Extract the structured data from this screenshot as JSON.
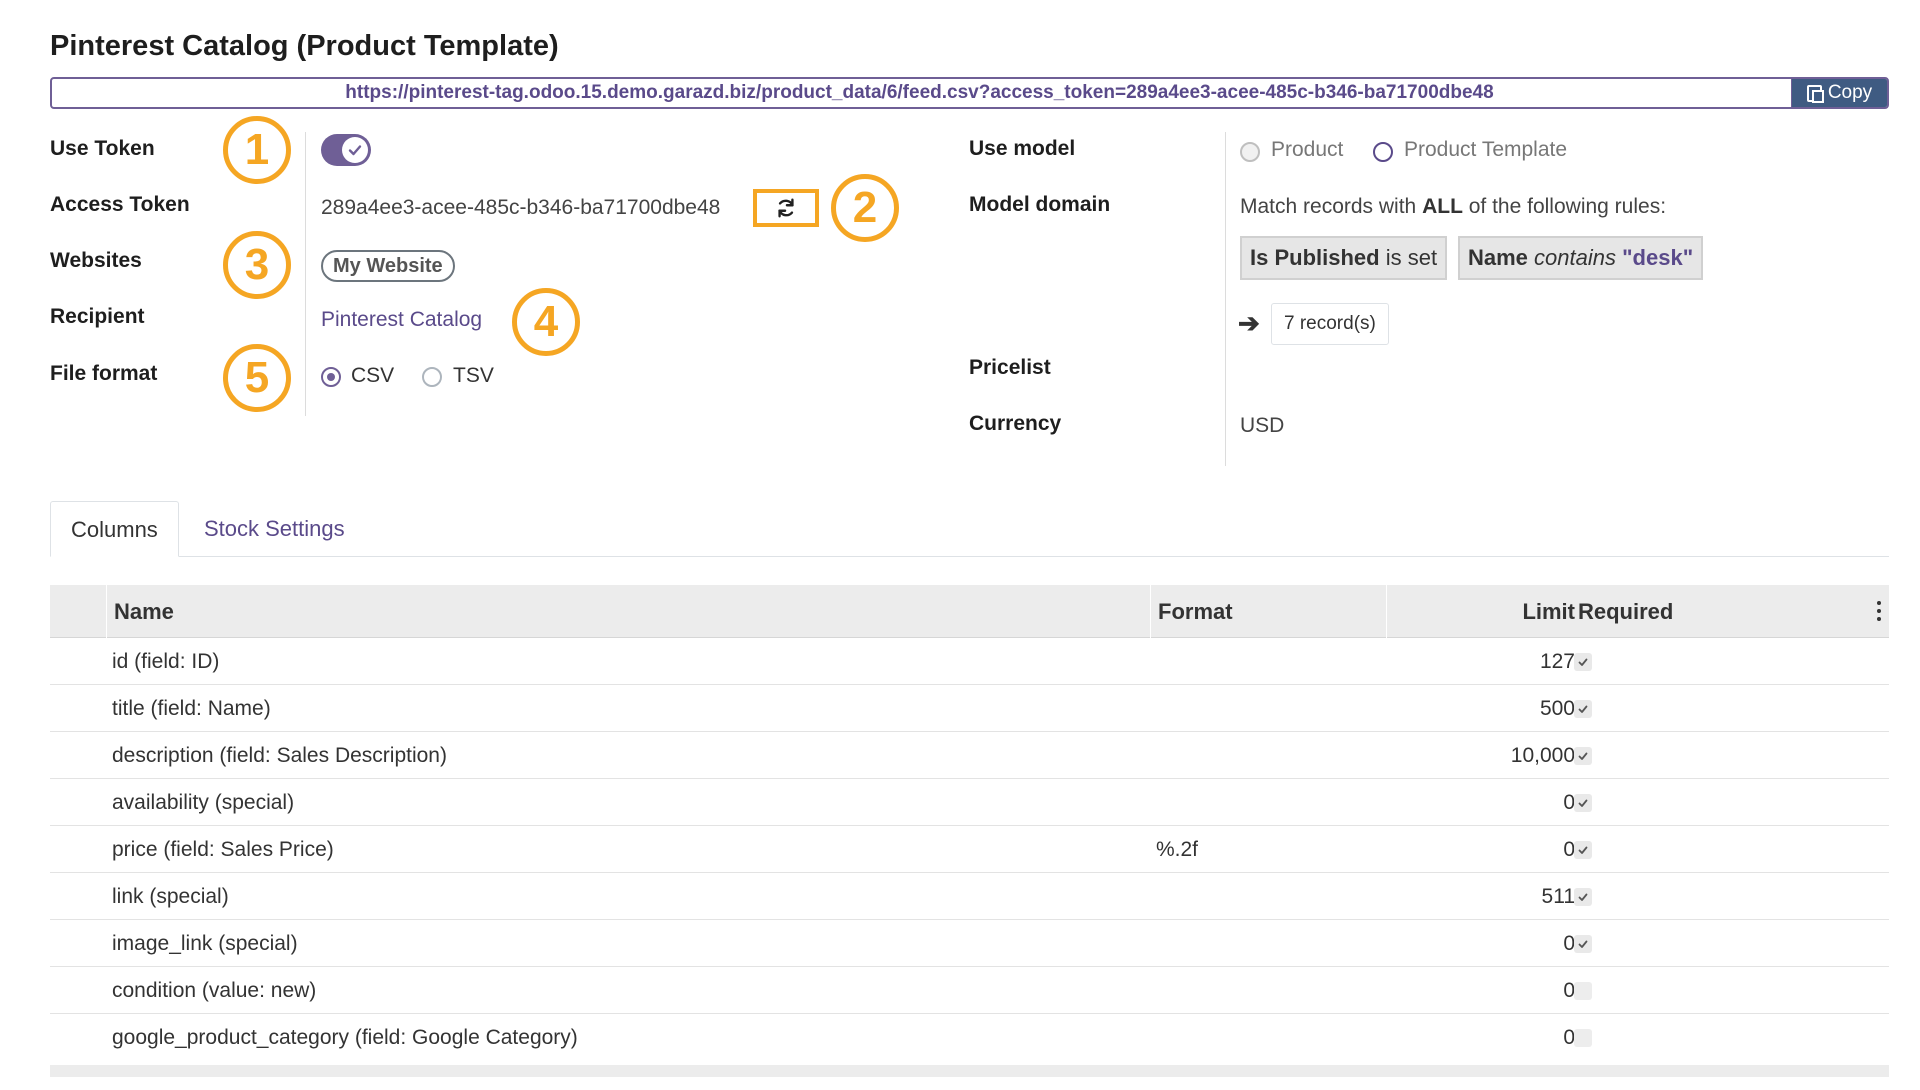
{
  "header": {
    "title": "Pinterest Catalog (Product Template)",
    "feed_url": "https://pinterest-tag.odoo.15.demo.garazd.biz/product_data/6/feed.csv?access_token=289a4ee3-acee-485c-b346-ba71700dbe48",
    "copy_label": "Copy"
  },
  "left_fields": {
    "use_token_label": "Use Token",
    "use_token_value": true,
    "access_token_label": "Access Token",
    "access_token_value": "289a4ee3-acee-485c-b346-ba71700dbe48",
    "websites_label": "Websites",
    "websites_tag": "My Website",
    "recipient_label": "Recipient",
    "recipient_value": "Pinterest Catalog",
    "file_format_label": "File format",
    "file_format_options": [
      "CSV",
      "TSV"
    ],
    "file_format_selected": "CSV"
  },
  "right_fields": {
    "use_model_label": "Use model",
    "use_model_options": [
      "Product",
      "Product Template"
    ],
    "model_domain_label": "Model domain",
    "domain_prefix": "Match records with",
    "domain_all": "ALL",
    "domain_suffix": "of the following rules:",
    "rule1_field": "Is Published",
    "rule1_op": "is set",
    "rule2_field": "Name",
    "rule2_op": "contains",
    "rule2_value": "\"desk\"",
    "records_label": "7 record(s)",
    "pricelist_label": "Pricelist",
    "currency_label": "Currency",
    "currency_value": "USD"
  },
  "callouts": [
    "1",
    "2",
    "3",
    "4",
    "5"
  ],
  "tabs": [
    {
      "label": "Columns",
      "active": true
    },
    {
      "label": "Stock Settings",
      "active": false
    }
  ],
  "table": {
    "headers": {
      "name": "Name",
      "format": "Format",
      "limit": "Limit",
      "required": "Required"
    },
    "rows": [
      {
        "name": "id (field: ID)",
        "format": "",
        "limit": "127",
        "required": true
      },
      {
        "name": "title (field: Name)",
        "format": "",
        "limit": "500",
        "required": true
      },
      {
        "name": "description (field: Sales Description)",
        "format": "",
        "limit": "10,000",
        "required": true
      },
      {
        "name": "availability (special)",
        "format": "",
        "limit": "0",
        "required": true
      },
      {
        "name": "price (field: Sales Price)",
        "format": "%.2f",
        "limit": "0",
        "required": true
      },
      {
        "name": "link (special)",
        "format": "",
        "limit": "511",
        "required": true
      },
      {
        "name": "image_link (special)",
        "format": "",
        "limit": "0",
        "required": true
      },
      {
        "name": "condition (value: new)",
        "format": "",
        "limit": "0",
        "required": false
      },
      {
        "name": "google_product_category (field: Google Category)",
        "format": "",
        "limit": "0",
        "required": false
      }
    ]
  },
  "colors": {
    "primary": "#6f5f96",
    "link": "#5a4a8a",
    "callout": "#f5a623",
    "copy_button": "#3f5b82"
  },
  "icons": {
    "copy": "copy-icon",
    "refresh": "refresh-icon",
    "toggle_check": "check-icon",
    "records_arrow": "arrow-right-icon",
    "row_check": "check-icon",
    "column_menu": "kebab-icon"
  }
}
